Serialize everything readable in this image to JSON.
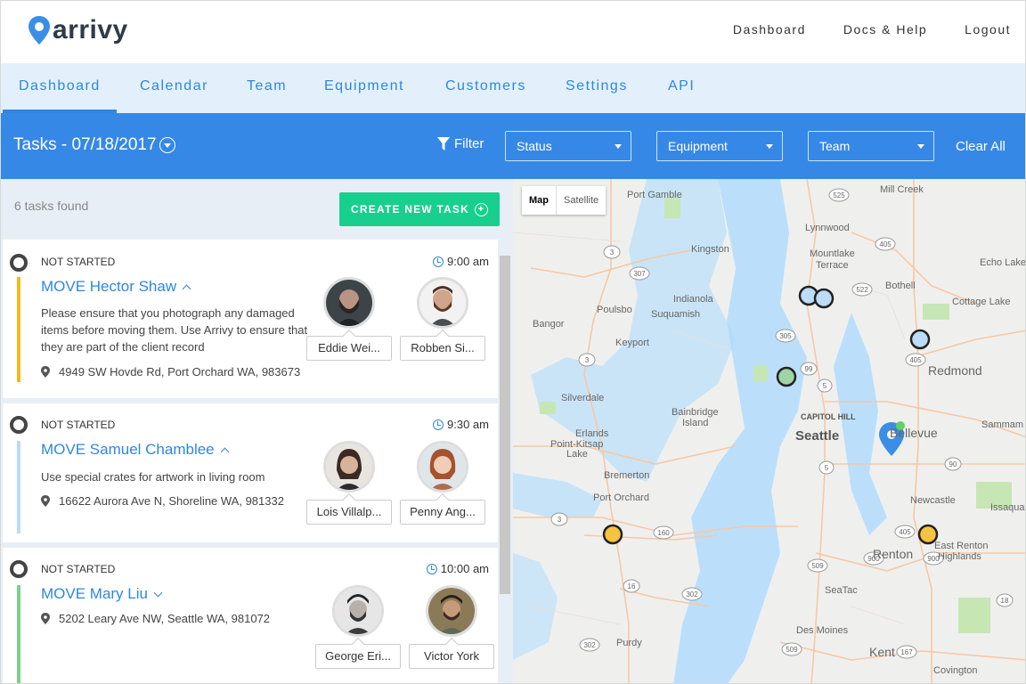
{
  "brand": {
    "name": "arrivy",
    "accent": "#2f87e0",
    "green": "#18cf8e"
  },
  "toplinks": [
    "Dashboard",
    "Docs & Help",
    "Logout"
  ],
  "nav": [
    "Dashboard",
    "Calendar",
    "Team",
    "Equipment",
    "Customers",
    "Settings",
    "API"
  ],
  "toolbar": {
    "title": "Tasks - 07/18/2017",
    "filter": "Filter",
    "status": "Status",
    "equipment": "Equipment",
    "team": "Team",
    "clear": "Clear All"
  },
  "list": {
    "found": "6 tasks found",
    "create": "CREATE NEW TASK",
    "tasks": [
      {
        "status": "NOT STARTED",
        "time": "9:00 am",
        "title": "MOVE Hector Shaw",
        "desc": "Please ensure that you photograph any damaged items before moving them. Use Arrivy to ensure that they are part of the client record",
        "address": "4949 SW Hovde Rd, Port Orchard WA, 983673",
        "color": "#f5b81c",
        "people": [
          "Eddie Wei...",
          "Robben Si..."
        ]
      },
      {
        "status": "NOT STARTED",
        "time": "9:30 am",
        "title": "MOVE Samuel Chamblee",
        "desc": "Use special crates for artwork in living room",
        "address": "16622 Aurora Ave N, Shoreline WA, 981332",
        "color": "#bcdcf7",
        "people": [
          "Lois Villalp...",
          "Penny Ang..."
        ]
      },
      {
        "status": "NOT STARTED",
        "time": "10:00 am",
        "title": "MOVE Mary Liu",
        "desc": "",
        "address": "5202 Leary Ave NW, Seattle WA, 981072",
        "color": "#7fcf8a",
        "people": [
          "George Eri...",
          "Victor York"
        ]
      }
    ]
  },
  "map": {
    "buttons": [
      "Map",
      "Satellite"
    ],
    "labels": {
      "port_gamble": "Port Gamble",
      "mill_creek": "Mill Creek",
      "lynnwood": "Lynnwood",
      "kingston": "Kingston",
      "mountlake": "Mountlake",
      "terrace": "Terrace",
      "echo_lake": "Echo Lake",
      "bothell": "Bothell",
      "cottage_lake": "Cottage Lake",
      "indianola": "Indianola",
      "poulsbo": "Poulsbo",
      "suquamish": "Suquamish",
      "bangor": "Bangor",
      "keyport": "Keyport",
      "redmond": "Redmond",
      "silverdale": "Silverdale",
      "capitol_hill": "CAPITOL HILL",
      "bainbridge": "Bainbridge",
      "island": "Island",
      "seattle": "Seattle",
      "bellevue": "Bellevue",
      "sammam": "Sammam",
      "erlands": "Erlands",
      "point_kitsap": "Point-Kitsap",
      "lake": "Lake",
      "bremerton": "Bremerton",
      "newcastle": "Newcastle",
      "issaqua": "Issaqua",
      "port_orchard": "Port Orchard",
      "east_renton": "East Renton",
      "highlands": "Highlands",
      "renton": "Renton",
      "seatac": "SeaTac",
      "des_moines": "Des Moines",
      "purdy": "Purdy",
      "kent": "Kent",
      "covington": "Covington"
    }
  }
}
